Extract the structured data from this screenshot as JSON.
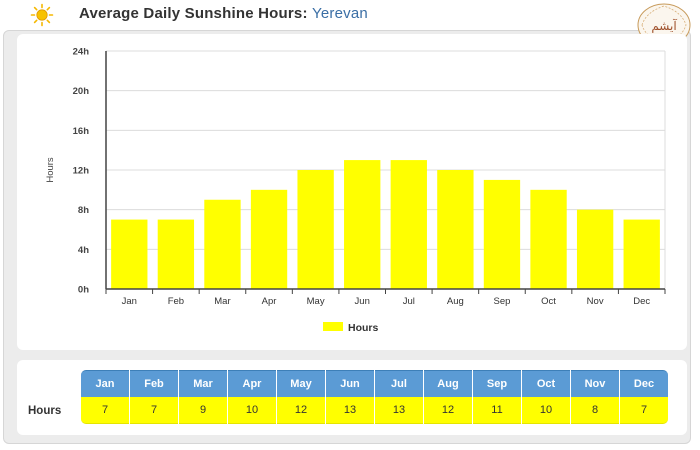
{
  "header": {
    "title_prefix": "Average Daily Sunshine Hours: ",
    "city": "Yerevan",
    "logo_text": "آیشم"
  },
  "colors": {
    "bar": "#ffff00",
    "header_blue": "#5b9bd5",
    "city_blue": "#3a6ea5",
    "sun": "#f5b800"
  },
  "chart_data": {
    "type": "bar",
    "categories": [
      "Jan",
      "Feb",
      "Mar",
      "Apr",
      "May",
      "Jun",
      "Jul",
      "Aug",
      "Sep",
      "Oct",
      "Nov",
      "Dec"
    ],
    "series": [
      {
        "name": "Hours",
        "values": [
          7,
          7,
          9,
          10,
          12,
          13,
          13,
          12,
          11,
          10,
          8,
          7
        ]
      }
    ],
    "ylabel": "Hours",
    "ylim": [
      0,
      24
    ],
    "yticks": [
      "0h",
      "4h",
      "8h",
      "12h",
      "16h",
      "20h",
      "24h"
    ],
    "grid": true,
    "legend": "bottom-center"
  },
  "table": {
    "row_label": "Hours"
  }
}
